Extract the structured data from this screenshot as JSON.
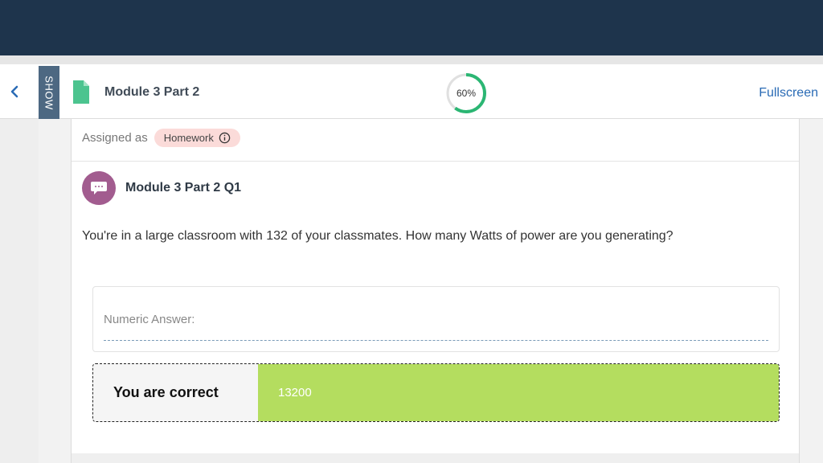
{
  "header": {
    "show_tab": "SHOW",
    "module_title": "Module 3 Part 2",
    "progress_label": "60%",
    "progress_fraction": 0.6,
    "fullscreen_label": "Fullscreen"
  },
  "assignment": {
    "assigned_label": "Assigned as",
    "badge_label": "Homework"
  },
  "question": {
    "title": "Module 3 Part 2 Q1",
    "text": "You're in a large classroom with 132 of your classmates.  How many Watts of power are you generating?"
  },
  "answer": {
    "label": "Numeric Answer:",
    "result_label": "You are correct",
    "result_value": "13200"
  },
  "colors": {
    "topbar": "#1e344c",
    "accent": "#2a6bb5",
    "progress_ring": "#2bb673",
    "badge_bg": "#fbdbd9",
    "avatar": "#a25c8f",
    "correct_bg": "#b4dd5f"
  },
  "icons": {
    "back": "chevron-left-icon",
    "document": "document-icon",
    "info": "info-icon",
    "question": "chat-bubble-icon"
  }
}
